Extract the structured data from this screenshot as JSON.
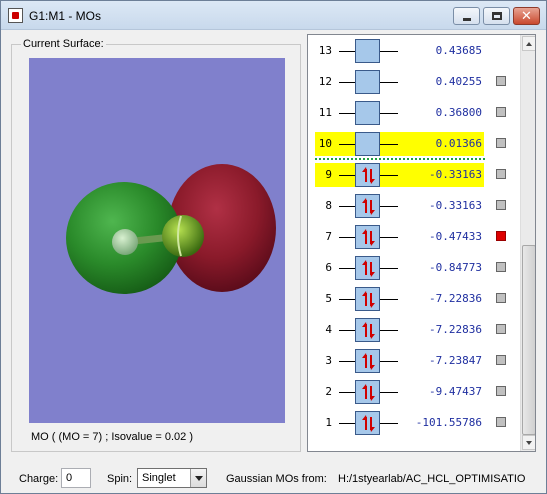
{
  "window": {
    "title": "G1:M1 - MOs",
    "minimize_label": "",
    "maximize_label": "",
    "close_label": "✕"
  },
  "surface": {
    "label": "Current Surface:",
    "caption": "MO ( (MO = 7) ; Isovalue = 0.02 )",
    "colors": {
      "background": "#8080cc",
      "positive_lobe": "#2a8a2a",
      "negative_lobe": "#8a1a2a"
    }
  },
  "orbitals": [
    {
      "num": "13",
      "energy": "0.43685",
      "occupied": false,
      "highlight": false,
      "selected": false,
      "checkbox": false
    },
    {
      "num": "12",
      "energy": "0.40255",
      "occupied": false,
      "highlight": false,
      "selected": false,
      "checkbox": true
    },
    {
      "num": "11",
      "energy": "0.36800",
      "occupied": false,
      "highlight": false,
      "selected": false,
      "checkbox": true
    },
    {
      "num": "10",
      "energy": "0.01366",
      "occupied": false,
      "highlight": true,
      "selected": false,
      "checkbox": true
    },
    {
      "num": "9",
      "energy": "-0.33163",
      "occupied": true,
      "highlight": true,
      "selected": false,
      "checkbox": true
    },
    {
      "num": "8",
      "energy": "-0.33163",
      "occupied": true,
      "highlight": false,
      "selected": false,
      "checkbox": true
    },
    {
      "num": "7",
      "energy": "-0.47433",
      "occupied": true,
      "highlight": false,
      "selected": true,
      "checkbox": true
    },
    {
      "num": "6",
      "energy": "-0.84773",
      "occupied": true,
      "highlight": false,
      "selected": false,
      "checkbox": true
    },
    {
      "num": "5",
      "energy": "-7.22836",
      "occupied": true,
      "highlight": false,
      "selected": false,
      "checkbox": true
    },
    {
      "num": "4",
      "energy": "-7.22836",
      "occupied": true,
      "highlight": false,
      "selected": false,
      "checkbox": true
    },
    {
      "num": "3",
      "energy": "-7.23847",
      "occupied": true,
      "highlight": false,
      "selected": false,
      "checkbox": true
    },
    {
      "num": "2",
      "energy": "-9.47437",
      "occupied": true,
      "highlight": false,
      "selected": false,
      "checkbox": true
    },
    {
      "num": "1",
      "energy": "-101.55786",
      "occupied": true,
      "highlight": false,
      "selected": false,
      "checkbox": true
    }
  ],
  "bottom": {
    "charge_label": "Charge:",
    "charge_value": "0",
    "spin_label": "Spin:",
    "spin_value": "Singlet",
    "source_label": "Gaussian MOs from:",
    "source_path": "H:/1styearlab/AC_HCL_OPTIMISATIO"
  },
  "colors": {
    "highlight": "#ffff00",
    "energy_text": "#1f2fa0",
    "selected_check": "#dd0000",
    "electron_arrow": "#d00000",
    "orbital_box": "#a6c8ea"
  }
}
